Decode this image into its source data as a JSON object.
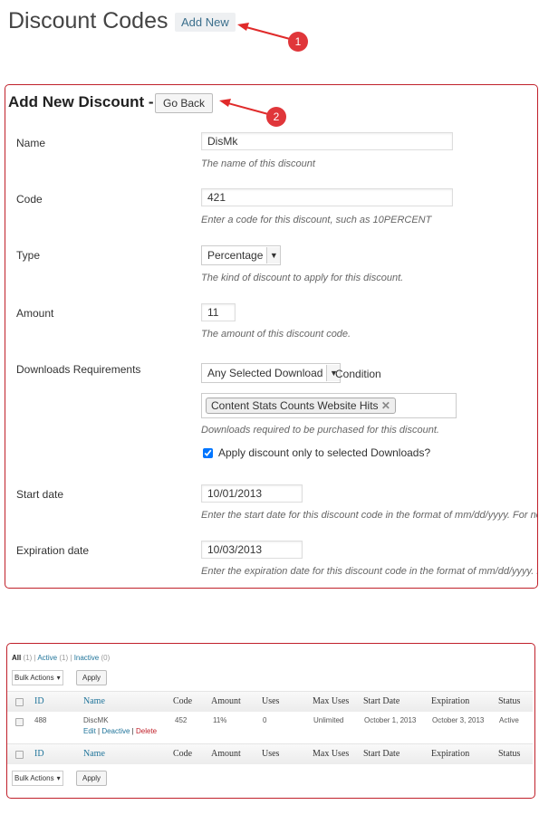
{
  "header": {
    "title": "Discount Codes",
    "add_new": "Add New"
  },
  "annotations": [
    "1",
    "2"
  ],
  "form": {
    "title": "Add New Discount -",
    "go_back": "Go Back",
    "fields": {
      "name": {
        "label": "Name",
        "value": "DisMk",
        "help": "The name of this discount"
      },
      "code": {
        "label": "Code",
        "value": "421",
        "help": "Enter a code for this discount, such as 10PERCENT"
      },
      "type": {
        "label": "Type",
        "value": "Percentage",
        "help": "The kind of discount to apply for this discount."
      },
      "amount": {
        "label": "Amount",
        "value": "11",
        "help": "The amount of this discount code."
      },
      "downloads": {
        "label": "Downloads Requirements",
        "select": "Any Selected Download",
        "condition": "Condition",
        "tag": "Content Stats Counts Website Hits",
        "help": "Downloads required to be purchased for this discount.",
        "checkbox_label": "Apply discount only to selected Downloads?",
        "checked": true
      },
      "start": {
        "label": "Start date",
        "value": "10/01/2013",
        "help": "Enter the start date for this discount code in the format of mm/dd/yyyy. For no start date, leave blank."
      },
      "expiration": {
        "label": "Expiration date",
        "value": "10/03/2013",
        "help": "Enter the expiration date for this discount code in the format of mm/dd/yyyy. For no expiration, leave blank."
      }
    }
  },
  "list": {
    "filters": [
      {
        "label": "All",
        "count": "(1)"
      },
      {
        "label": "Active",
        "count": "(1)"
      },
      {
        "label": "Inactive",
        "count": "(0)"
      }
    ],
    "bulk_actions": "Bulk Actions",
    "apply": "Apply",
    "columns": [
      "ID",
      "Name",
      "Code",
      "Amount",
      "Uses",
      "Max Uses",
      "Start Date",
      "Expiration",
      "Status"
    ],
    "rows": [
      {
        "id": "488",
        "name": "DiscMK",
        "code": "452",
        "amount": "11%",
        "uses": "0",
        "max_uses": "Unlimited",
        "start": "October 1, 2013",
        "expiration": "October 3, 2013",
        "status": "Active",
        "actions": {
          "edit": "Edit",
          "deactive": "Deactive",
          "delete": "Delete"
        }
      }
    ]
  }
}
